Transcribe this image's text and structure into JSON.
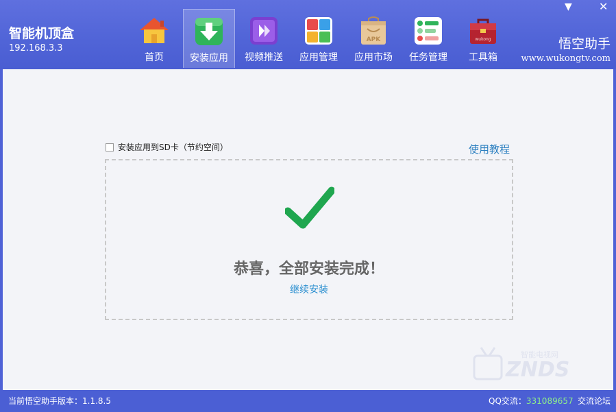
{
  "window": {
    "minimize_glyph": "▼",
    "close_glyph": "✕"
  },
  "brand": {
    "title": "智能机顶盒",
    "ip": "192.168.3.3"
  },
  "nav": {
    "items": [
      {
        "label": "首页",
        "icon": "home-icon"
      },
      {
        "label": "安装应用",
        "icon": "install-icon",
        "active": true
      },
      {
        "label": "视频推送",
        "icon": "video-push-icon"
      },
      {
        "label": "应用管理",
        "icon": "app-manage-icon"
      },
      {
        "label": "应用市场",
        "icon": "apk-market-icon"
      },
      {
        "label": "任务管理",
        "icon": "task-manage-icon"
      },
      {
        "label": "工具箱",
        "icon": "toolbox-icon"
      }
    ]
  },
  "site": {
    "name": "悟空助手",
    "url": "www.wukongtv.com"
  },
  "main": {
    "sd_option_label": "安装应用到SD卡（节约空间）",
    "sd_option_checked": false,
    "tutorial_link": "使用教程",
    "success_message": "恭喜，全部安装完成！",
    "continue_link": "继续安装"
  },
  "footer": {
    "version": "当前悟空助手版本：1.1.8.5",
    "qq_label": "QQ交流：",
    "qq_number": "331089657",
    "forum_link": "交流论坛"
  },
  "colors": {
    "header_bg": "#5064d7",
    "check_green": "#1fa64f",
    "link_blue": "#2b8fd0",
    "qq_green": "#8ff08a"
  }
}
